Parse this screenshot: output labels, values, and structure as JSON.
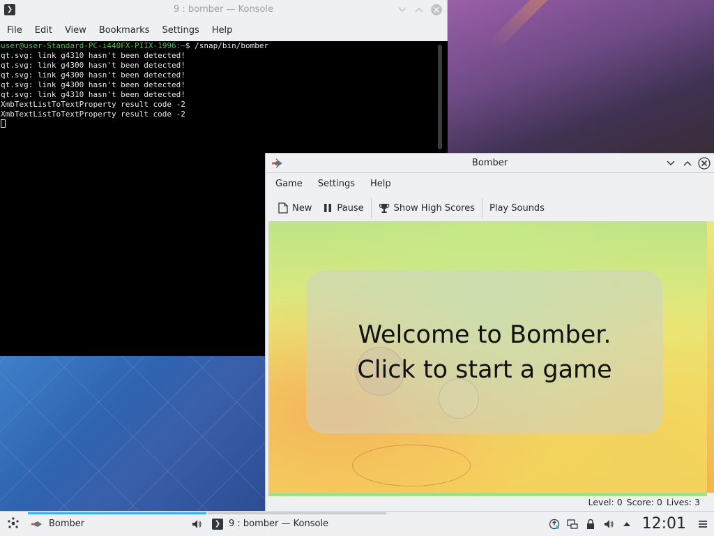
{
  "konsole": {
    "title": "9 : bomber — Konsole",
    "menu": [
      "File",
      "Edit",
      "View",
      "Bookmarks",
      "Settings",
      "Help"
    ],
    "terminal": {
      "prompt_user": "user@user-Standard-PC-i440FX-PIIX-1996",
      "prompt_path": ":~",
      "prompt_cmd": "$ /snap/bin/bomber",
      "lines": [
        "qt.svg: link g4310 hasn't been detected!",
        "qt.svg: link g4300 hasn't been detected!",
        "qt.svg: link g4300 hasn't been detected!",
        "qt.svg: link g4300 hasn't been detected!",
        "qt.svg: link g4310 hasn't been detected!",
        "XmbTextListToTextProperty result code -2",
        "XmbTextListToTextProperty result code -2"
      ]
    }
  },
  "bomber": {
    "title": "Bomber",
    "menu": [
      "Game",
      "Settings",
      "Help"
    ],
    "toolbar": {
      "new_label": "New",
      "pause_label": "Pause",
      "high_scores_label": "Show High Scores",
      "sounds_label": "Play Sounds"
    },
    "welcome": {
      "line1": "Welcome to Bomber.",
      "line2": "Click to start a game"
    },
    "status": {
      "level": "Level: 0",
      "score": "Score: 0",
      "lives": "Lives: 3"
    }
  },
  "taskbar": {
    "tasks": [
      {
        "label": "Bomber",
        "icon": "bomber-icon"
      },
      {
        "label": "9 : bomber — Konsole",
        "icon": "konsole-icon"
      }
    ],
    "clock": "12:01",
    "accent": "#3daee9"
  }
}
